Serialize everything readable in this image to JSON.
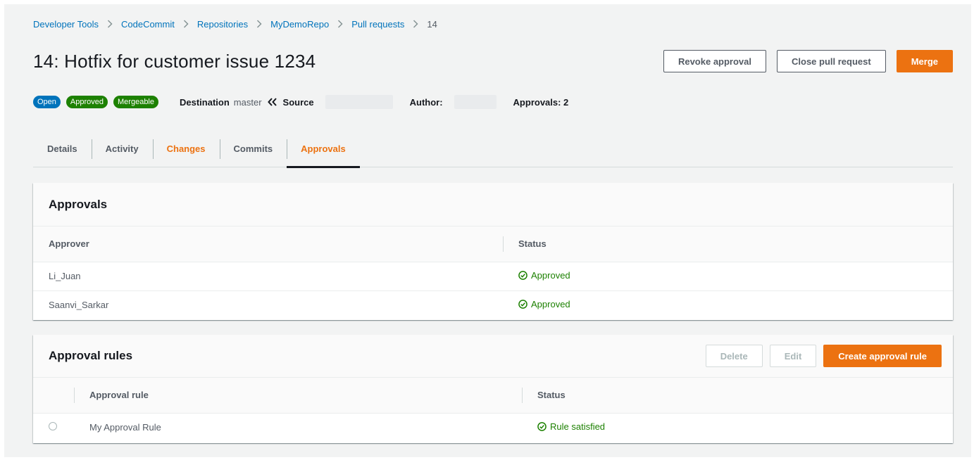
{
  "breadcrumb": [
    "Developer Tools",
    "CodeCommit",
    "Repositories",
    "MyDemoRepo",
    "Pull requests",
    "14"
  ],
  "title": "14: Hotfix for customer issue 1234",
  "actions": {
    "revoke": "Revoke approval",
    "close": "Close pull request",
    "merge": "Merge"
  },
  "badges": {
    "open": "Open",
    "approved": "Approved",
    "mergeable": "Mergeable"
  },
  "meta": {
    "destination_label": "Destination",
    "destination_value": "master",
    "source_label": "Source",
    "author_label": "Author:",
    "approvals_label": "Approvals: 2"
  },
  "tabs": [
    "Details",
    "Activity",
    "Changes",
    "Commits",
    "Approvals"
  ],
  "approvals_panel": {
    "title": "Approvals",
    "columns": [
      "Approver",
      "Status"
    ],
    "rows": [
      {
        "approver": "Li_Juan",
        "status": "Approved"
      },
      {
        "approver": "Saanvi_Sarkar",
        "status": "Approved"
      }
    ]
  },
  "rules_panel": {
    "title": "Approval rules",
    "buttons": {
      "delete": "Delete",
      "edit": "Edit",
      "create": "Create approval rule"
    },
    "columns": [
      "Approval rule",
      "Status"
    ],
    "rows": [
      {
        "rule": "My Approval Rule",
        "status": "Rule satisfied"
      }
    ]
  },
  "colors": {
    "accent": "#ec7211",
    "link": "#0073bb",
    "success": "#1d8102"
  }
}
